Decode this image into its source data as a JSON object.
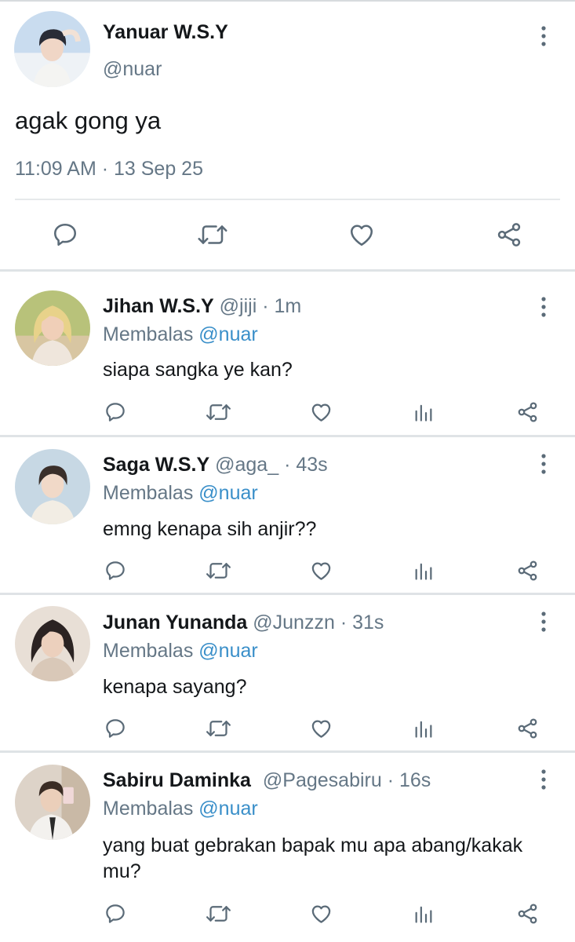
{
  "main_post": {
    "name": "Yanuar W.S.Y",
    "handle": "@nuar",
    "text": "agak gong ya",
    "timestamp": "11:09 AM · 13 Sep 25",
    "actions": [
      "reply-icon",
      "retweet-icon",
      "like-icon",
      "share-icon"
    ]
  },
  "replies": [
    {
      "name": "Jihan W.S.Y",
      "handle": "@jiji",
      "dot": "·",
      "time": "1m",
      "replying_prefix": "Membalas",
      "replying_to": "@nuar",
      "text": "siapa sangka ye kan?"
    },
    {
      "name": "Saga W.S.Y",
      "handle": "@aga_",
      "dot": "·",
      "time": "43s",
      "replying_prefix": "Membalas",
      "replying_to": "@nuar",
      "text": "emng kenapa sih anjir??"
    },
    {
      "name": "Junan Yunanda",
      "handle": "@Junzzn",
      "dot": "·",
      "time": "31s",
      "replying_prefix": "Membalas",
      "replying_to": "@nuar",
      "text": "kenapa sayang?"
    },
    {
      "name": "Sabiru Daminka",
      "handle": "@Pagesabiru",
      "dot": "·",
      "time": "16s",
      "replying_prefix": "Membalas",
      "replying_to": "@nuar",
      "text": "yang buat gebrakan bapak mu apa abang/kakak mu?"
    }
  ],
  "reply_actions": [
    "reply-icon",
    "retweet-icon",
    "like-icon",
    "analytics-icon",
    "share-icon"
  ],
  "colors": {
    "text": "#14171a",
    "secondary": "#657786",
    "mention": "#3a8fc9",
    "icon": "#5b6b78",
    "divider": "#e1e5e8"
  }
}
